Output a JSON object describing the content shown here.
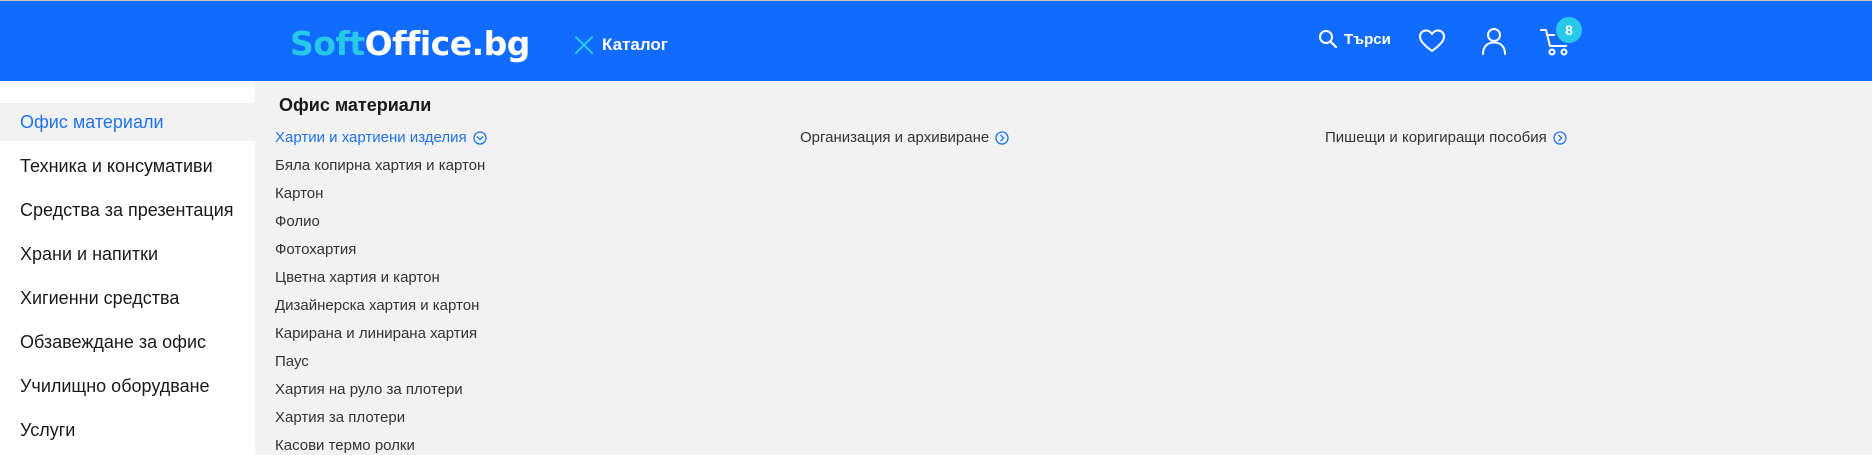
{
  "header": {
    "logo_part1": "Soft",
    "logo_part2": "Office.bg",
    "catalog_label": "Каталог",
    "search_label": "Търси",
    "cart_count": "8",
    "colors": {
      "bar": "#116bfe",
      "accent": "#27c8e8"
    }
  },
  "sidebar": {
    "items": [
      {
        "label": "Офис материали",
        "active": true
      },
      {
        "label": "Техника и консумативи"
      },
      {
        "label": "Средства за презентация"
      },
      {
        "label": "Храни и напитки"
      },
      {
        "label": "Хигиенни средства"
      },
      {
        "label": "Обзавеждане за офис"
      },
      {
        "label": "Училищно оборудване"
      },
      {
        "label": "Услуги"
      }
    ]
  },
  "main": {
    "title": "Офис материали",
    "columns": [
      {
        "label": "Хартии и хартиени изделия",
        "icon": "chevron-down-circle-icon",
        "expanded": true
      },
      {
        "label": "Организация и архивиране",
        "icon": "chevron-right-circle-icon"
      },
      {
        "label": "Пишещи и коригиращи пособия",
        "icon": "chevron-right-circle-icon"
      }
    ],
    "subitems": [
      "Бяла копирна хартия и картон",
      "Картон",
      "Фолио",
      "Фотохартия",
      "Цветна хартия и картон",
      "Дизайнерска хартия и картон",
      "Карирана и линирана хартия",
      "Паус",
      "Хартия на руло за плотери",
      "Хартия за плотери",
      "Касови термо ролки"
    ]
  }
}
